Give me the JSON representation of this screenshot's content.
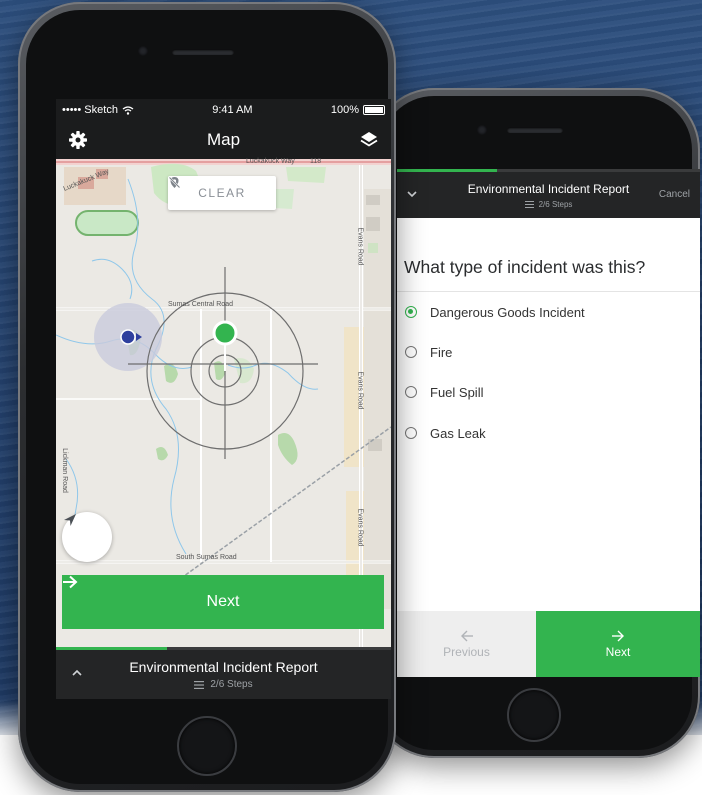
{
  "phone_map": {
    "status_bar": {
      "carrier": "••••• Sketch",
      "time": "9:41 AM",
      "battery": "100%"
    },
    "nav": {
      "title": "Map",
      "left_icon": "gear-icon",
      "right_icon": "layers-icon"
    },
    "map": {
      "clear_label": "CLEAR",
      "road_labels": {
        "lickman": "Luckakuck Way",
        "lickman2": "Luckakuck Way",
        "sumas_central": "Sumas Central Road",
        "south_sumas": "South Sumas Road",
        "evans1": "Evans Road",
        "evans2": "Evans Road",
        "evans3": "Evans Road",
        "left_road": "Lickman Road",
        "road_118": "118"
      }
    },
    "next_label": "Next",
    "report": {
      "title": "Environmental Incident Report",
      "steps": "2/6 Steps",
      "progress": 0.33
    }
  },
  "phone_question": {
    "header": {
      "title": "Environmental Incident Report",
      "steps": "2/6 Steps",
      "cancel": "Cancel",
      "progress": 0.33
    },
    "question": "What type of incident was this?",
    "options": [
      {
        "label": "Dangerous Goods Incident",
        "selected": true
      },
      {
        "label": "Fire",
        "selected": false
      },
      {
        "label": "Fuel Spill",
        "selected": false
      },
      {
        "label": "Gas Leak",
        "selected": false
      }
    ],
    "footer": {
      "previous": "Previous",
      "next": "Next"
    }
  },
  "colors": {
    "accent": "#33b44f",
    "dark_bar": "#242526",
    "location_dot": "#2e3f9e"
  }
}
